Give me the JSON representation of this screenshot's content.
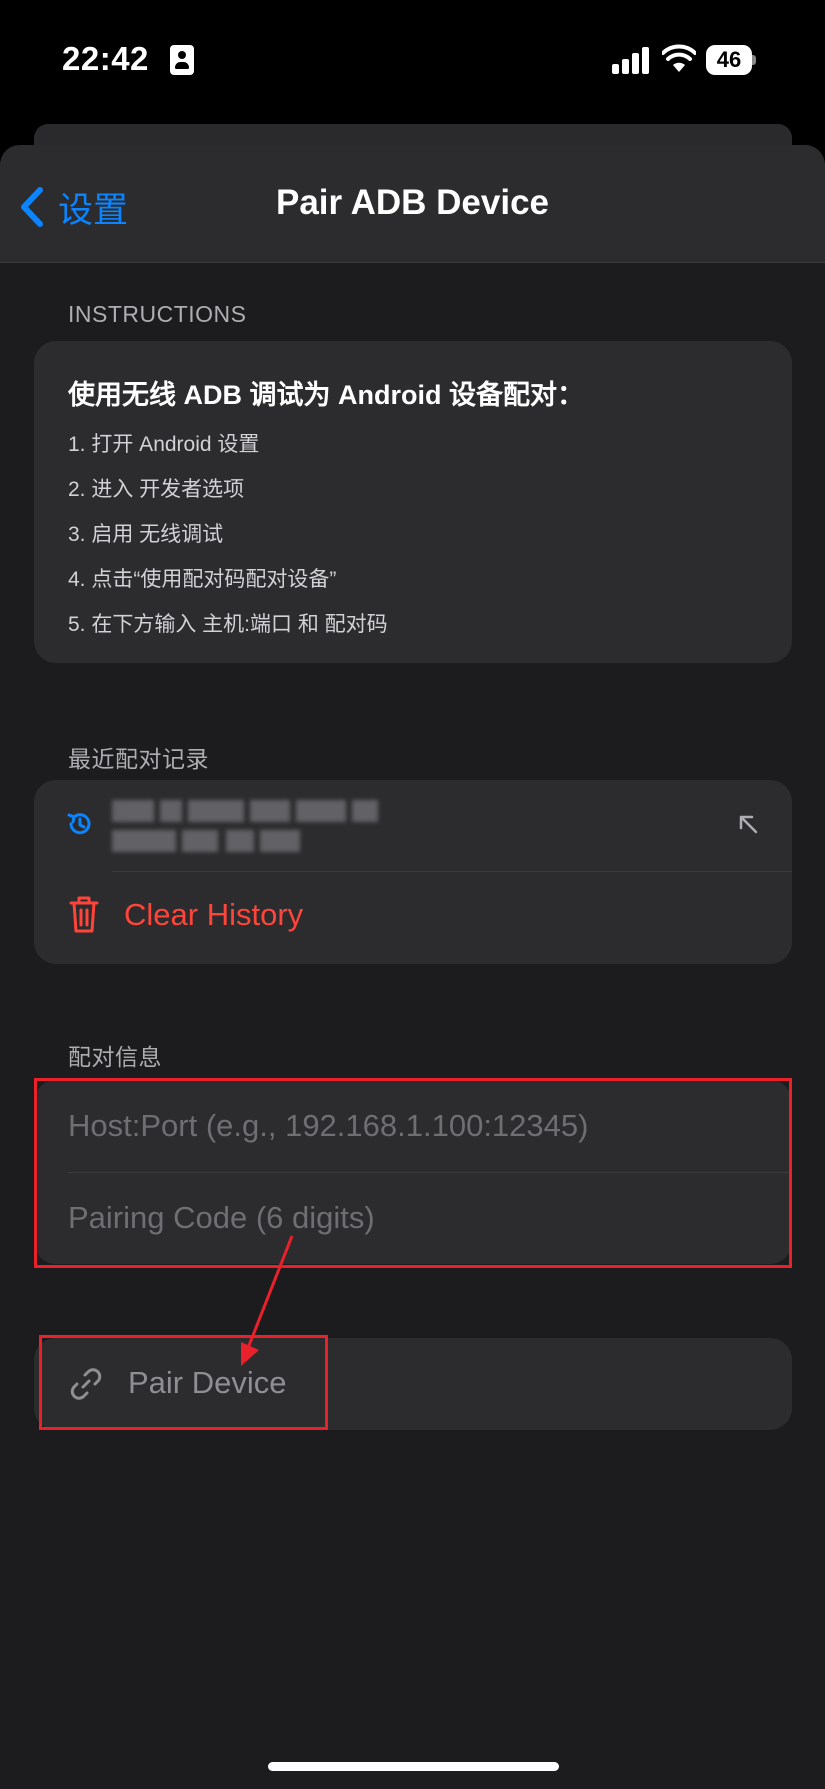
{
  "status_bar": {
    "time": "22:42",
    "battery": "46"
  },
  "nav": {
    "back_label": "设置",
    "title": "Pair ADB Device"
  },
  "instructions": {
    "header": "INSTRUCTIONS",
    "title": "使用无线 ADB 调试为 Android 设备配对：",
    "steps": [
      "1. 打开 Android 设置",
      "2. 进入 开发者选项",
      "3. 启用 无线调试",
      "4. 点击“使用配对码配对设备”",
      "5. 在下方输入 主机:端口 和 配对码"
    ]
  },
  "history": {
    "header": "最近配对记录",
    "clear_label": "Clear History"
  },
  "pairing": {
    "header": "配对信息",
    "host_placeholder": "Host:Port (e.g., 192.168.1.100:12345)",
    "code_placeholder": "Pairing Code (6 digits)",
    "button_label": "Pair Device"
  },
  "colors": {
    "accent": "#0a84ff",
    "destructive": "#ff453a",
    "annotation": "#e8212b",
    "background": "#1c1c1e",
    "card": "#2c2c2e"
  }
}
